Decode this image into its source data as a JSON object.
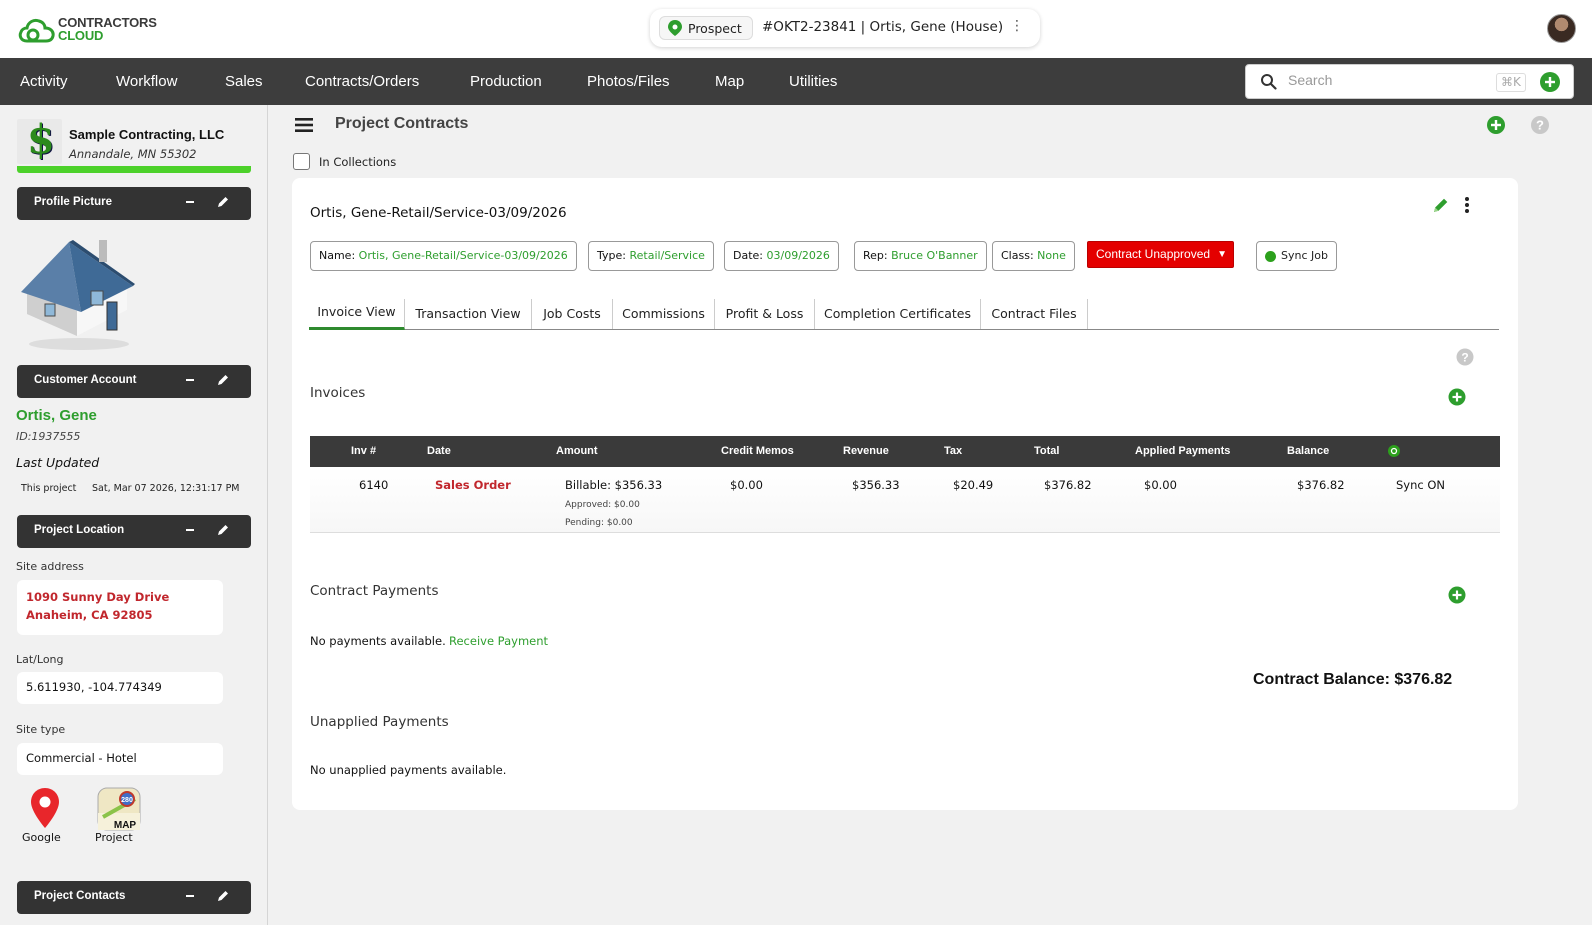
{
  "brand": {
    "line1": "CONTRACTORS",
    "line2": "CLOUD",
    "colors": {
      "green": "#2e9e2e",
      "dark": "#3d3d3d",
      "red": "#e40000"
    }
  },
  "job": {
    "status": "Prospect",
    "title": "#OKT2-23841 | Ortis, Gene (House)",
    "menu_glyph": "⋮"
  },
  "nav": {
    "items": [
      "Activity",
      "Workflow",
      "Sales",
      "Contracts/Orders",
      "Production",
      "Photos/Files",
      "Map",
      "Utilities"
    ],
    "search_placeholder": "Search",
    "shortcut": "⌘K"
  },
  "sidebar": {
    "company_name": "Sample Contracting, LLC",
    "company_address": "Annandale, MN 55302",
    "panels": {
      "profile_picture": "Profile Picture",
      "customer_account": "Customer Account",
      "project_location": "Project Location",
      "project_contacts": "Project Contacts"
    },
    "customer": {
      "name": "Ortis, Gene",
      "id": "ID:1937555",
      "last_updated_label": "Last Updated",
      "this_project_label": "This project",
      "this_project_date": "Sat, Mar 07 2026, 12:31:17 PM"
    },
    "location": {
      "site_address_label": "Site address",
      "address_line1": "1090 Sunny Day Drive",
      "address_line2": "Anaheim, CA 92805",
      "latlong_label": "Lat/Long",
      "latlong": "5.611930, -104.774349",
      "site_type_label": "Site type",
      "site_type": "Commercial - Hotel",
      "map_links": [
        "Google",
        "Project"
      ],
      "map_badge_text": "MAP",
      "map_sign_text": "280"
    }
  },
  "main": {
    "page_title": "Project Contracts",
    "in_collections": "In Collections",
    "contract": {
      "title": "Ortis, Gene-Retail/Service-03/09/2026",
      "chips": [
        {
          "label": "Name:",
          "value": "Ortis, Gene-Retail/Service-03/09/2026"
        },
        {
          "label": "Type:",
          "value": "Retail/Service"
        },
        {
          "label": "Date:",
          "value": "03/09/2026"
        },
        {
          "label": "Rep:",
          "value": "Bruce O'Banner"
        },
        {
          "label": "Class:",
          "value": "None"
        }
      ],
      "status": "Contract Unapproved",
      "sync_job": "Sync Job"
    },
    "tabs": [
      "Invoice View",
      "Transaction View",
      "Job Costs",
      "Commissions",
      "Profit & Loss",
      "Completion Certificates",
      "Contract Files"
    ],
    "invoices": {
      "heading": "Invoices",
      "columns": [
        "Inv #",
        "Date",
        "Amount",
        "Credit Memos",
        "Revenue",
        "Tax",
        "Total",
        "Applied Payments",
        "Balance"
      ],
      "rows": [
        {
          "inv": "6140",
          "date": "Sales Order",
          "amount": "Billable: $356.33",
          "approved": "Approved: $0.00",
          "pending": "Pending: $0.00",
          "credit_memos": "$0.00",
          "revenue": "$356.33",
          "tax": "$20.49",
          "total": "$376.82",
          "applied_payments": "$0.00",
          "balance": "$376.82",
          "sync": "Sync ON"
        }
      ]
    },
    "payments": {
      "heading": "Contract Payments",
      "empty": "No payments available.",
      "receive": "Receive Payment",
      "contract_balance": "Contract Balance: $376.82"
    },
    "unapplied": {
      "heading": "Unapplied Payments",
      "empty": "No unapplied payments available."
    }
  }
}
